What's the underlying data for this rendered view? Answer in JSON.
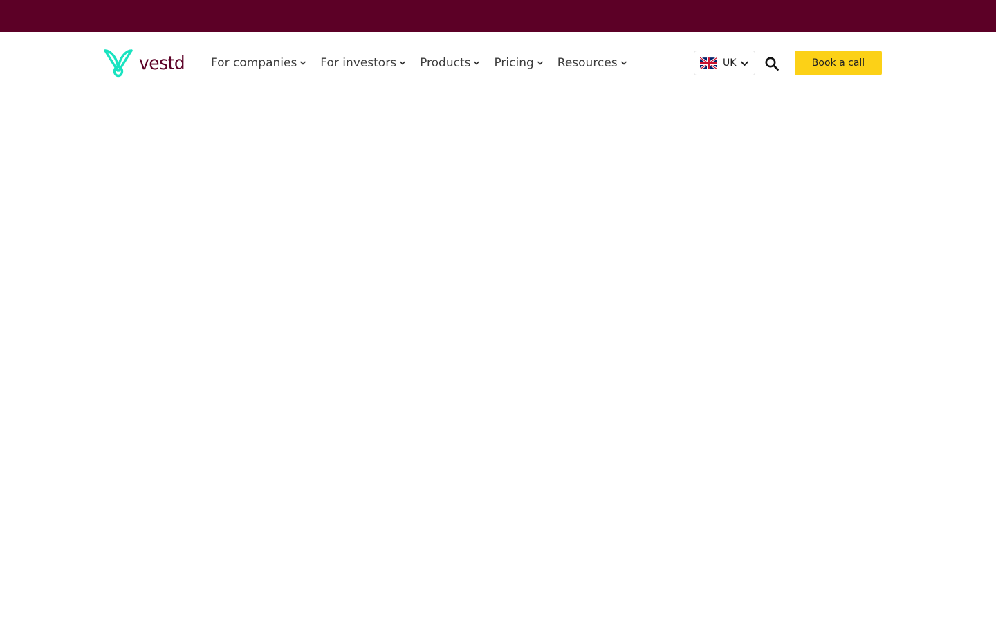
{
  "banner": {
    "color": "#5c0026"
  },
  "brand": {
    "name": "vestd",
    "mark_color": "#19e3c0",
    "text_color": "#5c0026",
    "icon": "vestd-v-logo"
  },
  "nav": {
    "items": [
      {
        "label": "For companies",
        "icon": "chevron-down-icon"
      },
      {
        "label": "For investors",
        "icon": "chevron-down-icon"
      },
      {
        "label": "Products",
        "icon": "chevron-down-icon"
      },
      {
        "label": "Pricing",
        "icon": "chevron-down-icon"
      },
      {
        "label": "Resources",
        "icon": "chevron-down-icon"
      }
    ]
  },
  "region": {
    "selected": "UK",
    "flag_icon": "uk-flag-icon"
  },
  "search": {
    "icon": "search-icon"
  },
  "cta": {
    "label": "Book a call",
    "color": "#fcd117"
  }
}
